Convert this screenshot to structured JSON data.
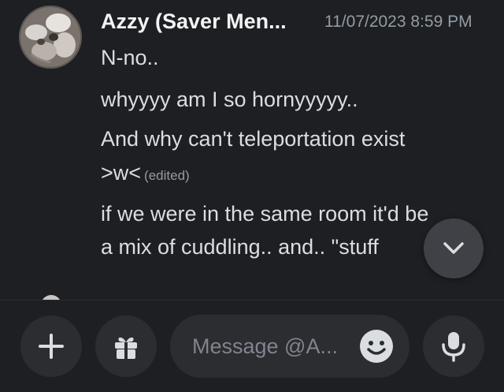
{
  "message": {
    "author": "Azzy (Saver Men...",
    "timestamp": "11/07/2023 8:59 PM",
    "lines": [
      "N-no..",
      "whyyyy am I so hornyyyyy..",
      "And why can't teleportation exist",
      ">w<",
      "if we were in the same room it'd be",
      "a mix of cuddling..  and.. \"stuff"
    ],
    "edited_label": "(edited)"
  },
  "composer": {
    "placeholder": "Message @A..."
  },
  "icons": {
    "scroll_down": "chevron-down-icon",
    "add": "plus-icon",
    "gift": "gift-icon",
    "emoji": "emoji-icon",
    "voice": "microphone-icon"
  },
  "colors": {
    "background": "#1e1f22",
    "surface": "#2b2d31",
    "text": "#dbdee1",
    "muted": "#949ba4"
  }
}
